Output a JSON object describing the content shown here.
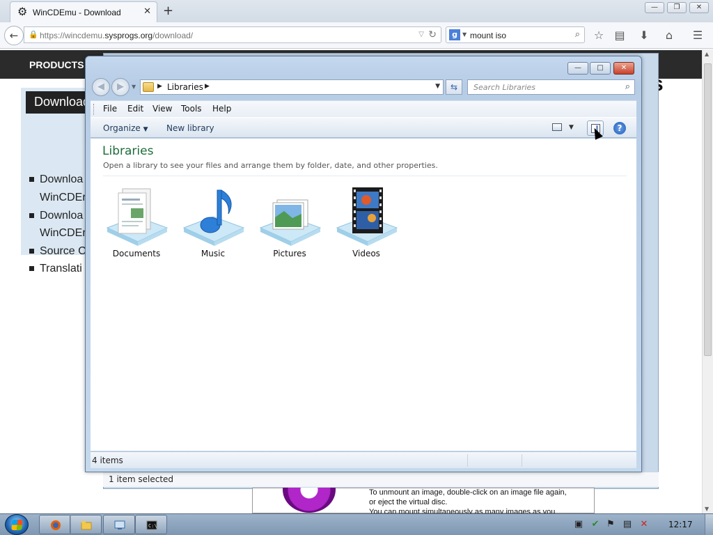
{
  "browser": {
    "tab_title": "WinCDEmu - Download",
    "tab_close": "✕",
    "new_tab": "+",
    "url_prefix": "https://wincdemu.",
    "url_domain": "sysprogs.org",
    "url_path": "/download/",
    "search_engine_letter": "g",
    "search_value": "mount iso",
    "window_buttons": [
      "—",
      "❐",
      "✕"
    ]
  },
  "web_page": {
    "nav_item": "PRODUCTS",
    "sidebar_heading": "Download",
    "sidebar_links": [
      "Downloa",
      "WinCDEr",
      "Downloa",
      "WinCDEr",
      "Source C",
      "Translati"
    ],
    "logo_fragment": "s",
    "bg_body_lines": [
      "To unmount an image, double-click on an image file again,",
      "or eject the virtual disc.",
      "You can mount simultaneously as many images as you"
    ]
  },
  "background_window": {
    "status_text": "1 item selected"
  },
  "explorer": {
    "window_buttons": [
      "—",
      "□",
      "✕"
    ],
    "nav_back": "◀",
    "nav_forward": "▶",
    "address_crumb": "Libraries",
    "search_placeholder": "Search Libraries",
    "menu": [
      {
        "label": "File",
        "key": "F"
      },
      {
        "label": "Edit",
        "key": "E"
      },
      {
        "label": "View",
        "key": "V"
      },
      {
        "label": "Tools",
        "key": "T"
      },
      {
        "label": "Help",
        "key": "H"
      }
    ],
    "toolbar": {
      "organize": "Organize",
      "new_library": "New library",
      "help": "?"
    },
    "content": {
      "heading": "Libraries",
      "subheading": "Open a library to see your files and arrange them by folder, date, and other properties."
    },
    "libraries": [
      {
        "name": "Documents",
        "icon": "documents-icon"
      },
      {
        "name": "Music",
        "icon": "music-icon"
      },
      {
        "name": "Pictures",
        "icon": "pictures-icon"
      },
      {
        "name": "Videos",
        "icon": "videos-icon"
      }
    ],
    "status_text": "4 items"
  },
  "taskbar": {
    "pinned": [
      "firefox-icon",
      "explorer-icon",
      "network-manager-icon",
      "cmd-icon"
    ],
    "clock": "12:17"
  },
  "colors": {
    "library_heading": "#1e6b3a",
    "window_frame": "#b7cde6",
    "taskbar": "#8aa3bd"
  }
}
